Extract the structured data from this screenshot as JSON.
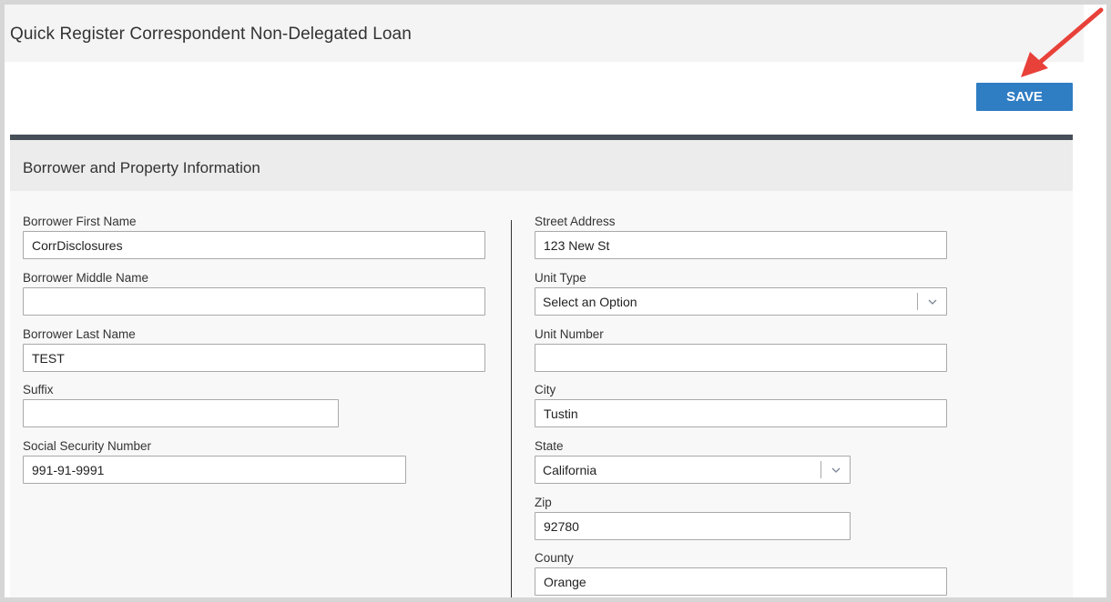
{
  "header": {
    "title": "Quick Register Correspondent Non-Delegated Loan"
  },
  "toolbar": {
    "save_label": "SAVE"
  },
  "colors": {
    "accent": "#2f7dc3",
    "section_border": "#464e58",
    "annotation_arrow": "#e8413a"
  },
  "section": {
    "title": "Borrower and Property Information"
  },
  "borrower": {
    "first_name": {
      "label": "Borrower First Name",
      "value": "CorrDisclosures"
    },
    "middle_name": {
      "label": "Borrower Middle Name",
      "value": ""
    },
    "last_name": {
      "label": "Borrower Last Name",
      "value": "TEST"
    },
    "suffix": {
      "label": "Suffix",
      "value": ""
    },
    "ssn": {
      "label": "Social Security Number",
      "value": "991-91-9991"
    }
  },
  "property": {
    "street_address": {
      "label": "Street Address",
      "value": "123 New St"
    },
    "unit_type": {
      "label": "Unit Type",
      "value": "Select an Option"
    },
    "unit_number": {
      "label": "Unit Number",
      "value": ""
    },
    "city": {
      "label": "City",
      "value": "Tustin"
    },
    "state": {
      "label": "State",
      "value": "California"
    },
    "zip": {
      "label": "Zip",
      "value": "92780"
    },
    "county": {
      "label": "County",
      "value": "Orange"
    }
  },
  "icons": {
    "dropdown": "chevron-down-icon",
    "annotation": "arrow-icon"
  }
}
